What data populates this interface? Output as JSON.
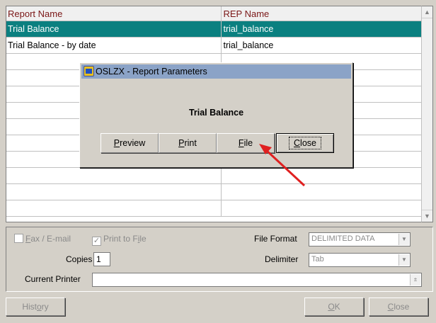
{
  "grid": {
    "headers": {
      "name": "Report Name",
      "rep": "REP Name"
    },
    "rows": [
      {
        "name": "Trial Balance",
        "rep": "trial_balance",
        "selected": true
      },
      {
        "name": "Trial Balance - by date",
        "rep": "trial_balance",
        "selected": false
      }
    ],
    "empty_row_count": 10
  },
  "options": {
    "fax_email_label": "Fax / E-mail",
    "fax_email_checked": false,
    "print_to_file_label": "Print to File",
    "print_to_file_checked": true,
    "file_format_label": "File Format",
    "file_format_value": "DELIMITED DATA",
    "copies_label": "Copies",
    "copies_value": "1",
    "delimiter_label": "Delimiter",
    "delimiter_value": "Tab",
    "current_printer_label": "Current Printer",
    "current_printer_value": ""
  },
  "buttons": {
    "history": "History",
    "ok": "OK",
    "close": "Close"
  },
  "dialog": {
    "title": "OSLZX - Report Parameters",
    "heading": "Trial Balance",
    "buttons": {
      "preview": "Preview",
      "print": "Print",
      "file": "File",
      "close": "Close"
    }
  },
  "annotation": {
    "arrow_color": "#e02020"
  },
  "colors": {
    "selection": "#0b8080",
    "header_text": "#7a1616",
    "titlebar": "#8ba3c7"
  }
}
